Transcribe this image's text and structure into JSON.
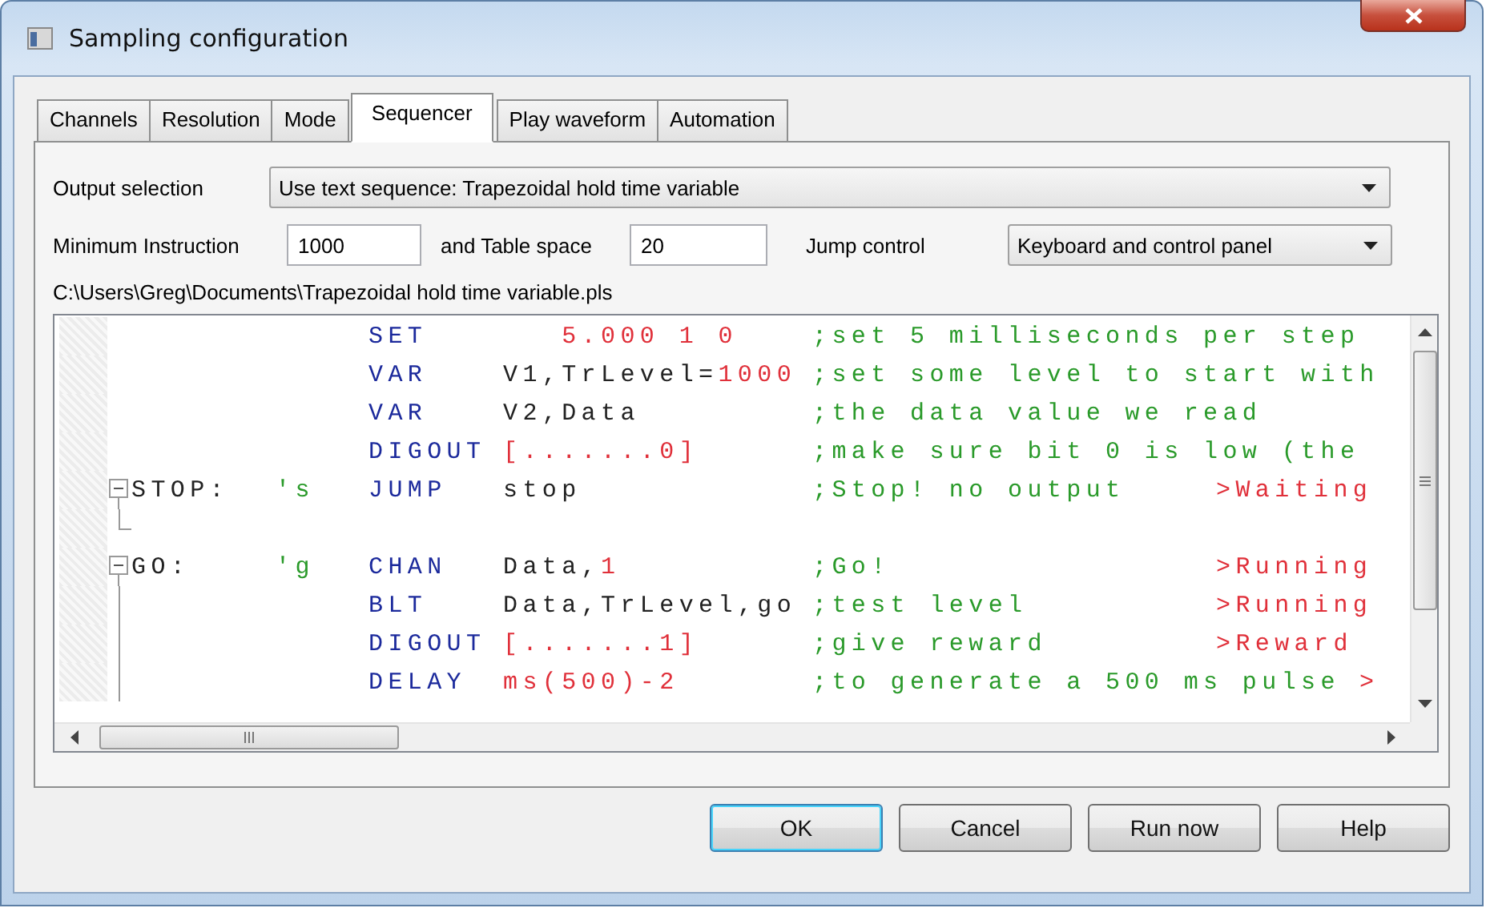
{
  "window": {
    "title": "Sampling configuration"
  },
  "tabs": [
    {
      "label": "Channels",
      "selected": false
    },
    {
      "label": "Resolution",
      "selected": false
    },
    {
      "label": "Mode",
      "selected": false
    },
    {
      "label": "Sequencer",
      "selected": true
    },
    {
      "label": "Play waveform",
      "selected": false
    },
    {
      "label": "Automation",
      "selected": false
    }
  ],
  "output_selection": {
    "label": "Output selection",
    "value": "Use text sequence: Trapezoidal hold time variable"
  },
  "minimum_instruction": {
    "label": "Minimum Instruction",
    "value": "1000"
  },
  "table_space": {
    "label": "and Table space",
    "value": "20"
  },
  "jump_control": {
    "label": "Jump control",
    "value": "Keyboard and control panel"
  },
  "file_path": "C:\\Users\\Greg\\Documents\\Trapezoidal hold time variable.pls",
  "code_lines": [
    {
      "op": "SET",
      "args": [
        {
          "kind": "number",
          "text": "   5.000 1 0"
        }
      ],
      "comment": ";set 5 milliseconds per step"
    },
    {
      "op": "VAR",
      "args": [
        {
          "kind": "plain",
          "text": "V1,TrLevel="
        },
        {
          "kind": "number",
          "text": "1000"
        }
      ],
      "comment": ";set some level to start with"
    },
    {
      "op": "VAR",
      "args": [
        {
          "kind": "plain",
          "text": "V2,Data"
        }
      ],
      "comment": ";the data value we read"
    },
    {
      "op": "DIGOUT",
      "args": [
        {
          "kind": "number",
          "text": "[.......0]"
        }
      ],
      "comment": ";make sure bit 0 is low (the"
    },
    {
      "label": "STOP:",
      "key": "'s",
      "op": "JUMP",
      "args": [
        {
          "kind": "plain",
          "text": "stop"
        }
      ],
      "comment": ";Stop! no output",
      "status": ">Waiting",
      "fold": {
        "kind": "start",
        "expanded": true
      }
    },
    {
      "fold": {
        "kind": "end"
      }
    },
    {
      "label": "GO:",
      "key": "'g",
      "op": "CHAN",
      "args": [
        {
          "kind": "plain",
          "text": "Data,"
        },
        {
          "kind": "number",
          "text": "1"
        }
      ],
      "comment": ";Go!",
      "status": ">Running",
      "fold": {
        "kind": "start",
        "expanded": true
      }
    },
    {
      "op": "BLT",
      "args": [
        {
          "kind": "plain",
          "text": "Data,TrLevel,go"
        }
      ],
      "comment": ";test level",
      "status": ">Running",
      "fold": {
        "kind": "body"
      }
    },
    {
      "op": "DIGOUT",
      "args": [
        {
          "kind": "number",
          "text": "[.......1]"
        }
      ],
      "comment": ";give reward",
      "status": ">Reward",
      "fold": {
        "kind": "body"
      }
    },
    {
      "op": "DELAY",
      "args": [
        {
          "kind": "number",
          "text": "ms(500)-2"
        }
      ],
      "comment": ";to generate a 500 ms pulse",
      "status": ">",
      "fold": {
        "kind": "body"
      }
    }
  ],
  "buttons": [
    {
      "label": "OK",
      "default": true
    },
    {
      "label": "Cancel",
      "default": false
    },
    {
      "label": "Run now",
      "default": false
    },
    {
      "label": "Help",
      "default": false
    }
  ]
}
